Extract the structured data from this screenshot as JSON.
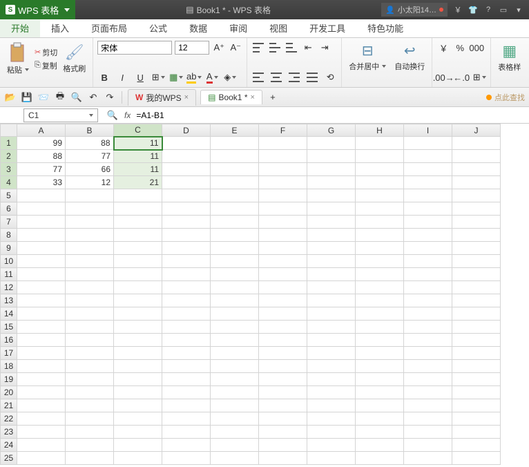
{
  "app": {
    "name": "WPS 表格",
    "doc_title": "Book1 * - WPS 表格"
  },
  "user": {
    "name": "小太阳14…"
  },
  "menu": {
    "tabs": [
      "开始",
      "插入",
      "页面布局",
      "公式",
      "数据",
      "审阅",
      "视图",
      "开发工具",
      "特色功能"
    ],
    "active": 0
  },
  "ribbon": {
    "paste": "粘贴",
    "cut": "剪切",
    "copy": "复制",
    "format_painter": "格式刷",
    "font": "宋体",
    "font_size": "12",
    "merge_center": "合并居中",
    "auto_wrap": "自动换行",
    "currency": "￥",
    "percent": "%",
    "cell_style": "表格样"
  },
  "quick": {
    "my_wps": "我的WPS",
    "book": "Book1 *",
    "hint": "点此查找"
  },
  "formula": {
    "cell_ref": "C1",
    "value": "=A1-B1"
  },
  "chart_data": {
    "type": "table",
    "columns": [
      "A",
      "B",
      "C",
      "D",
      "E",
      "F",
      "G",
      "H",
      "I",
      "J"
    ],
    "visible_rows": 25,
    "data": [
      {
        "A": 99,
        "B": 88,
        "C": 11
      },
      {
        "A": 88,
        "B": 77,
        "C": 11
      },
      {
        "A": 77,
        "B": 66,
        "C": 11
      },
      {
        "A": 33,
        "B": 12,
        "C": 21
      }
    ],
    "selection": {
      "range": "C1:C4",
      "active": "C1"
    }
  }
}
